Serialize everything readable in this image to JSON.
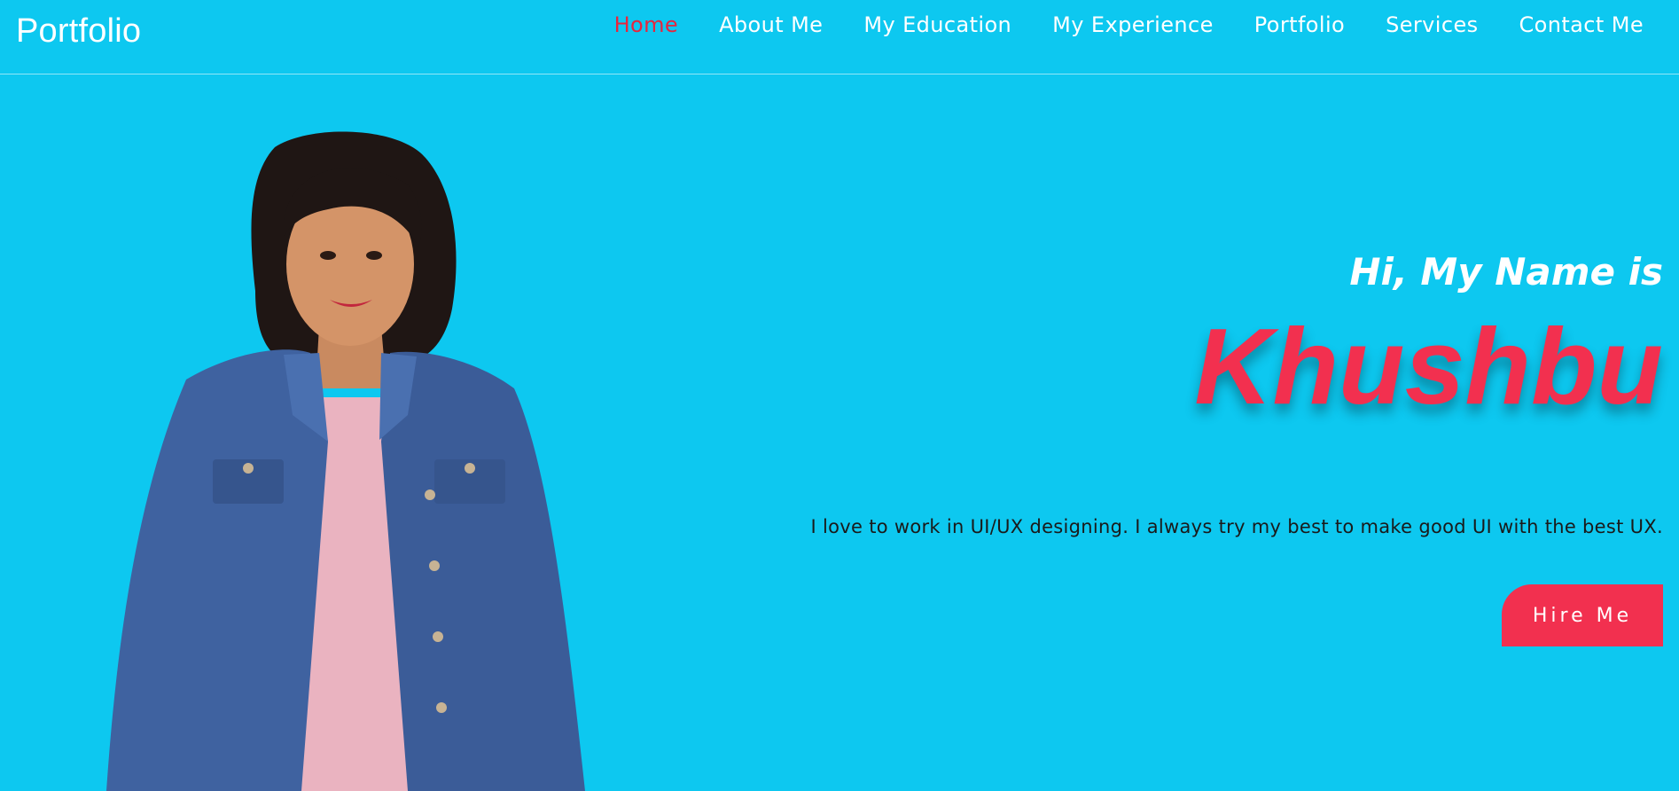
{
  "header": {
    "brand": "Portfolio",
    "nav": [
      {
        "label": "Home",
        "active": true
      },
      {
        "label": "About Me"
      },
      {
        "label": "My Education"
      },
      {
        "label": "My Experience"
      },
      {
        "label": "Portfolio"
      },
      {
        "label": "Services"
      },
      {
        "label": "Contact Me"
      }
    ]
  },
  "hero": {
    "greeting": "Hi, My Name is",
    "name": "Khushbu",
    "tagline": "I love to work in UI/UX designing. I always try my best to make good UI with the best UX.",
    "cta_label": "Hire Me"
  },
  "colors": {
    "background": "#0dc8f0",
    "accent": "#f2304f",
    "active_nav": "#e8253d",
    "text_light": "#ffffff",
    "text_dark": "#1a1a1a"
  },
  "images": {
    "portrait": "portrait-photo"
  }
}
